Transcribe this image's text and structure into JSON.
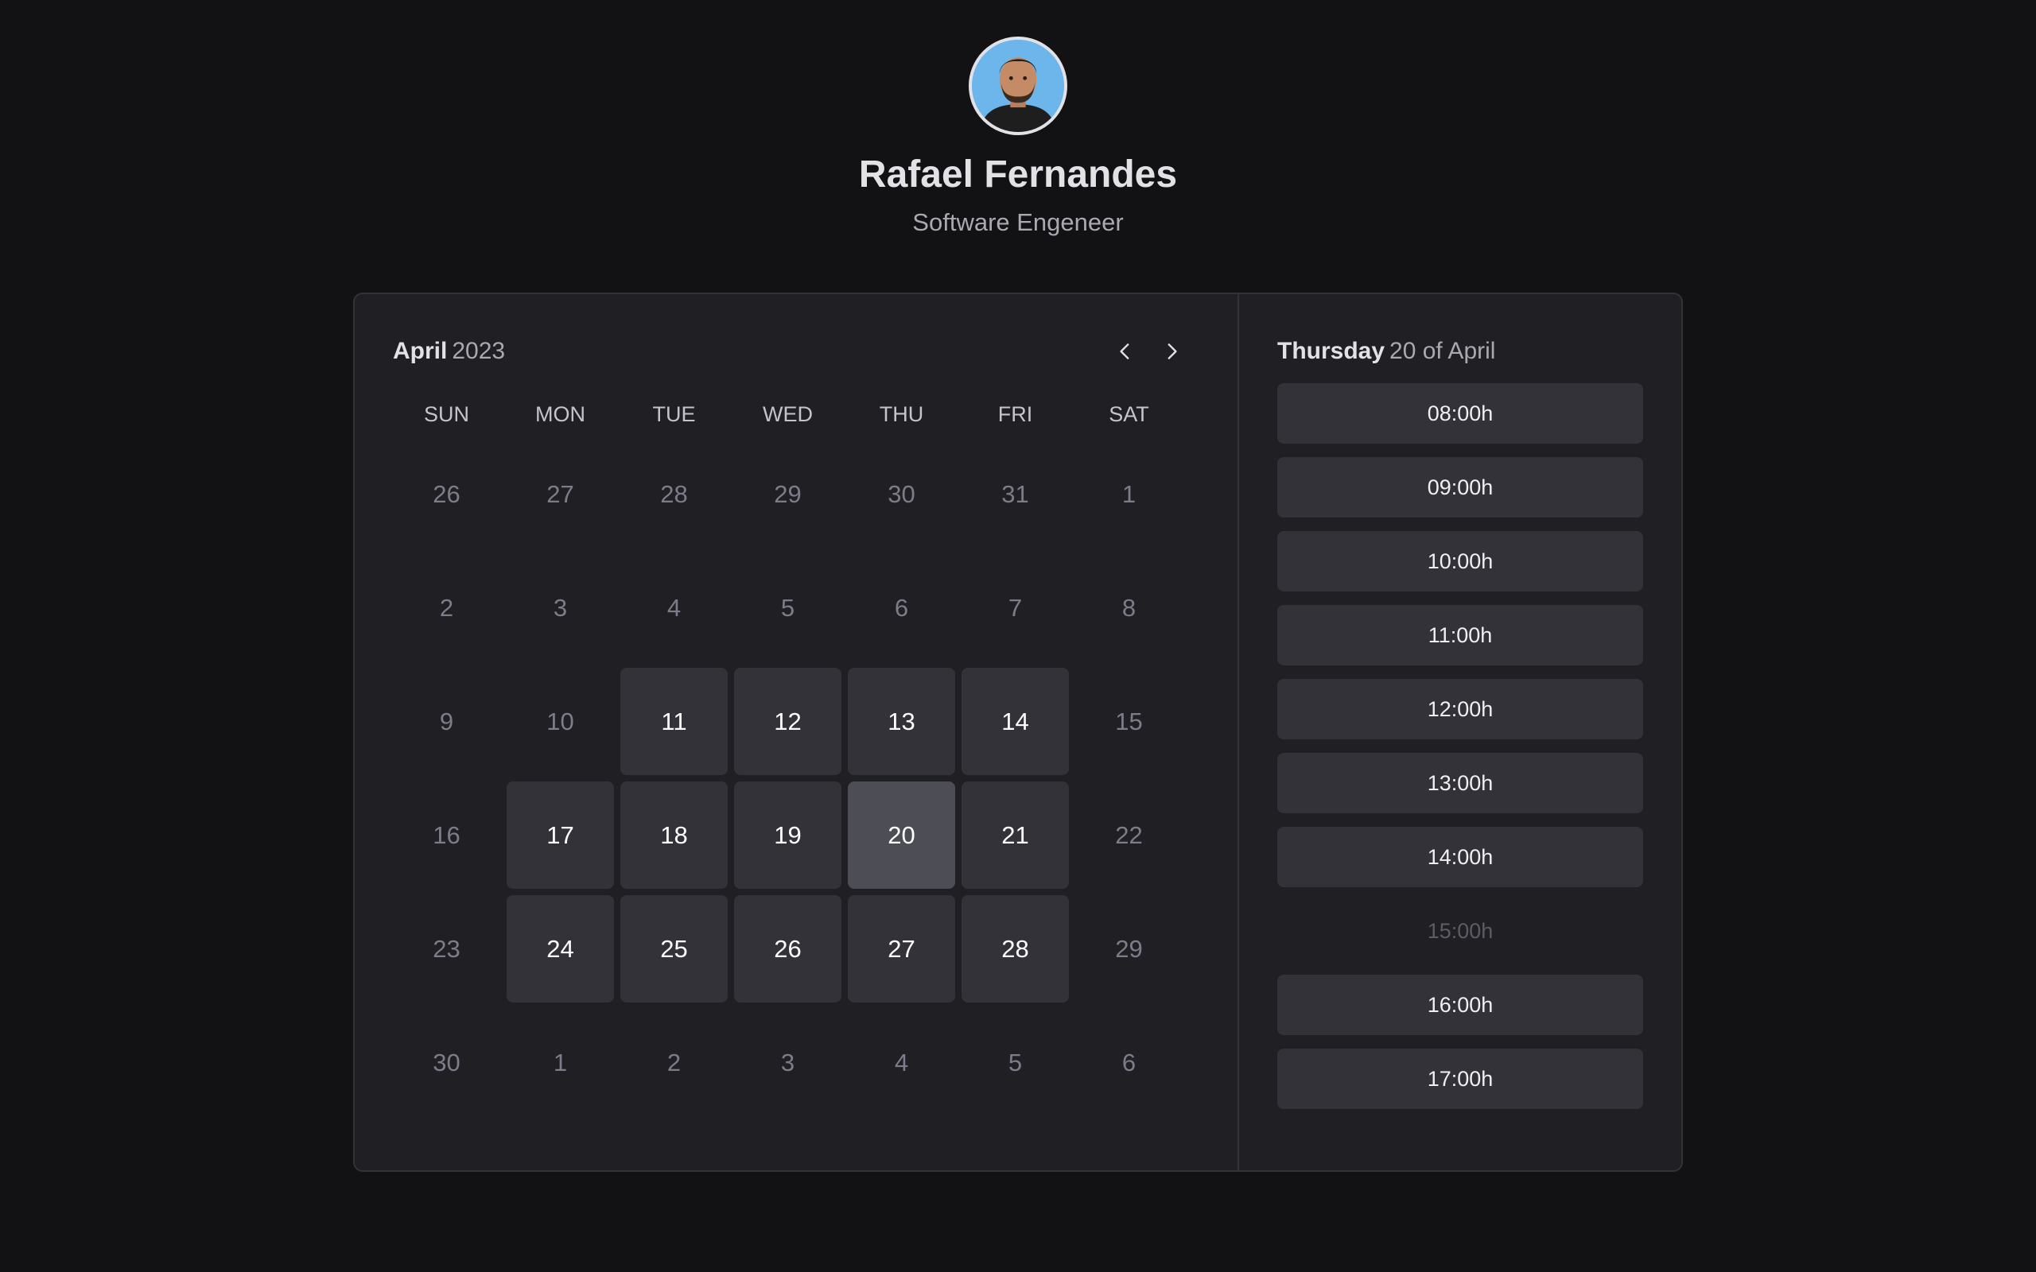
{
  "profile": {
    "name": "Rafael Fernandes",
    "role": "Software Engeneer"
  },
  "calendar": {
    "month": "April",
    "year": "2023",
    "weekdays": [
      "SUN",
      "MON",
      "TUE",
      "WED",
      "THU",
      "FRI",
      "SAT"
    ],
    "weeks": [
      [
        {
          "d": "26",
          "s": "out"
        },
        {
          "d": "27",
          "s": "out"
        },
        {
          "d": "28",
          "s": "out"
        },
        {
          "d": "29",
          "s": "out"
        },
        {
          "d": "30",
          "s": "out"
        },
        {
          "d": "31",
          "s": "out"
        },
        {
          "d": "1",
          "s": "off"
        }
      ],
      [
        {
          "d": "2",
          "s": "off"
        },
        {
          "d": "3",
          "s": "off"
        },
        {
          "d": "4",
          "s": "off"
        },
        {
          "d": "5",
          "s": "off"
        },
        {
          "d": "6",
          "s": "off"
        },
        {
          "d": "7",
          "s": "off"
        },
        {
          "d": "8",
          "s": "off"
        }
      ],
      [
        {
          "d": "9",
          "s": "off"
        },
        {
          "d": "10",
          "s": "off"
        },
        {
          "d": "11",
          "s": "avail"
        },
        {
          "d": "12",
          "s": "avail"
        },
        {
          "d": "13",
          "s": "avail"
        },
        {
          "d": "14",
          "s": "avail"
        },
        {
          "d": "15",
          "s": "off"
        }
      ],
      [
        {
          "d": "16",
          "s": "off"
        },
        {
          "d": "17",
          "s": "avail"
        },
        {
          "d": "18",
          "s": "avail"
        },
        {
          "d": "19",
          "s": "avail"
        },
        {
          "d": "20",
          "s": "selected"
        },
        {
          "d": "21",
          "s": "avail"
        },
        {
          "d": "22",
          "s": "off"
        }
      ],
      [
        {
          "d": "23",
          "s": "off"
        },
        {
          "d": "24",
          "s": "avail"
        },
        {
          "d": "25",
          "s": "avail"
        },
        {
          "d": "26",
          "s": "avail"
        },
        {
          "d": "27",
          "s": "avail"
        },
        {
          "d": "28",
          "s": "avail"
        },
        {
          "d": "29",
          "s": "off"
        }
      ],
      [
        {
          "d": "30",
          "s": "off"
        },
        {
          "d": "1",
          "s": "out"
        },
        {
          "d": "2",
          "s": "out"
        },
        {
          "d": "3",
          "s": "out"
        },
        {
          "d": "4",
          "s": "out"
        },
        {
          "d": "5",
          "s": "out"
        },
        {
          "d": "6",
          "s": "out"
        }
      ]
    ]
  },
  "timepicker": {
    "weekday": "Thursday",
    "date": "20 of April",
    "slots": [
      {
        "label": "08:00h",
        "available": true
      },
      {
        "label": "09:00h",
        "available": true
      },
      {
        "label": "10:00h",
        "available": true
      },
      {
        "label": "11:00h",
        "available": true
      },
      {
        "label": "12:00h",
        "available": true
      },
      {
        "label": "13:00h",
        "available": true
      },
      {
        "label": "14:00h",
        "available": true
      },
      {
        "label": "15:00h",
        "available": false
      },
      {
        "label": "16:00h",
        "available": true
      },
      {
        "label": "17:00h",
        "available": true
      }
    ]
  },
  "icons": {
    "prev": "chevron-left-icon",
    "next": "chevron-right-icon"
  },
  "colors": {
    "background": "#121214",
    "card": "#202024",
    "day_available": "#323238",
    "day_selected": "#4d4d55"
  }
}
